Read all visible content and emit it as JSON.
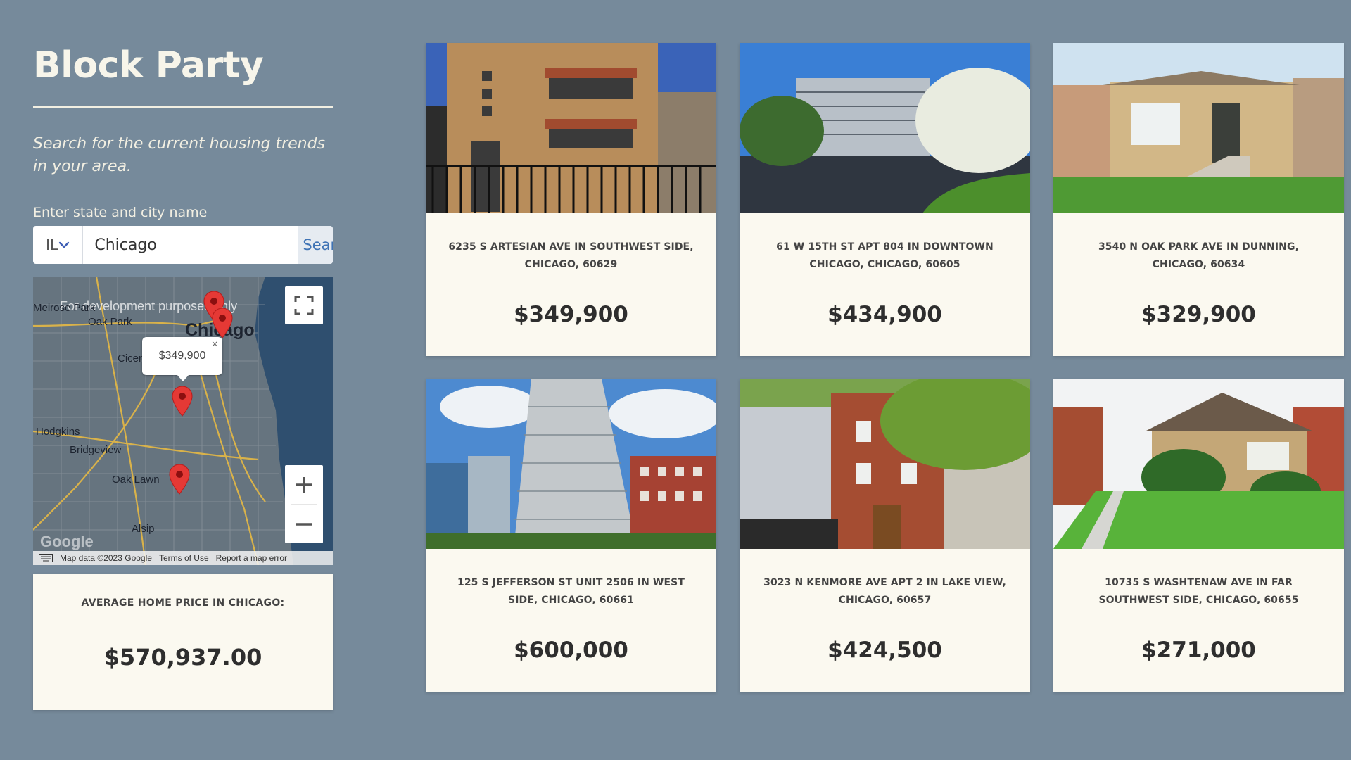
{
  "app": {
    "title": "Block Party",
    "tagline": "Search for the current housing trends in your area."
  },
  "search": {
    "label": "Enter state and city name",
    "state": "IL",
    "city": "Chicago",
    "button": "Search"
  },
  "map": {
    "watermark": "For development purposes only",
    "city_label": "Chicago",
    "places": [
      "Melrose Park",
      "Oak Park",
      "Cicero",
      "Hodgkins",
      "Bridgeview",
      "Oak Lawn",
      "Alsip"
    ],
    "popup_price": "$349,900",
    "popup_close": "×",
    "attribution": {
      "map_data": "Map data ©2023 Google",
      "terms": "Terms of Use",
      "report": "Report a map error"
    },
    "google_logo": "Google"
  },
  "average": {
    "label": "AVERAGE HOME PRICE IN CHICAGO:",
    "value": "$570,937.00"
  },
  "listings": [
    {
      "address": "6235 S ARTESIAN AVE IN SOUTHWEST SIDE, CHICAGO, 60629",
      "price": "$349,900"
    },
    {
      "address": "61 W 15TH ST APT 804 IN DOWNTOWN CHICAGO, CHICAGO, 60605",
      "price": "$434,900"
    },
    {
      "address": "3540 N OAK PARK AVE IN DUNNING, CHICAGO, 60634",
      "price": "$329,900"
    },
    {
      "address": "125 S JEFFERSON ST UNIT 2506 IN WEST SIDE, CHICAGO, 60661",
      "price": "$600,000"
    },
    {
      "address": "3023 N KENMORE AVE APT 2 IN LAKE VIEW, CHICAGO, 60657",
      "price": "$424,500"
    },
    {
      "address": "10735 S WASHTENAW AVE IN FAR SOUTHWEST SIDE, CHICAGO, 60655",
      "price": "$271,000"
    }
  ],
  "colors": {
    "background": "#768a9b",
    "card": "#fbf9f0",
    "pin": "#e53935",
    "search_text": "#3f73b5"
  }
}
